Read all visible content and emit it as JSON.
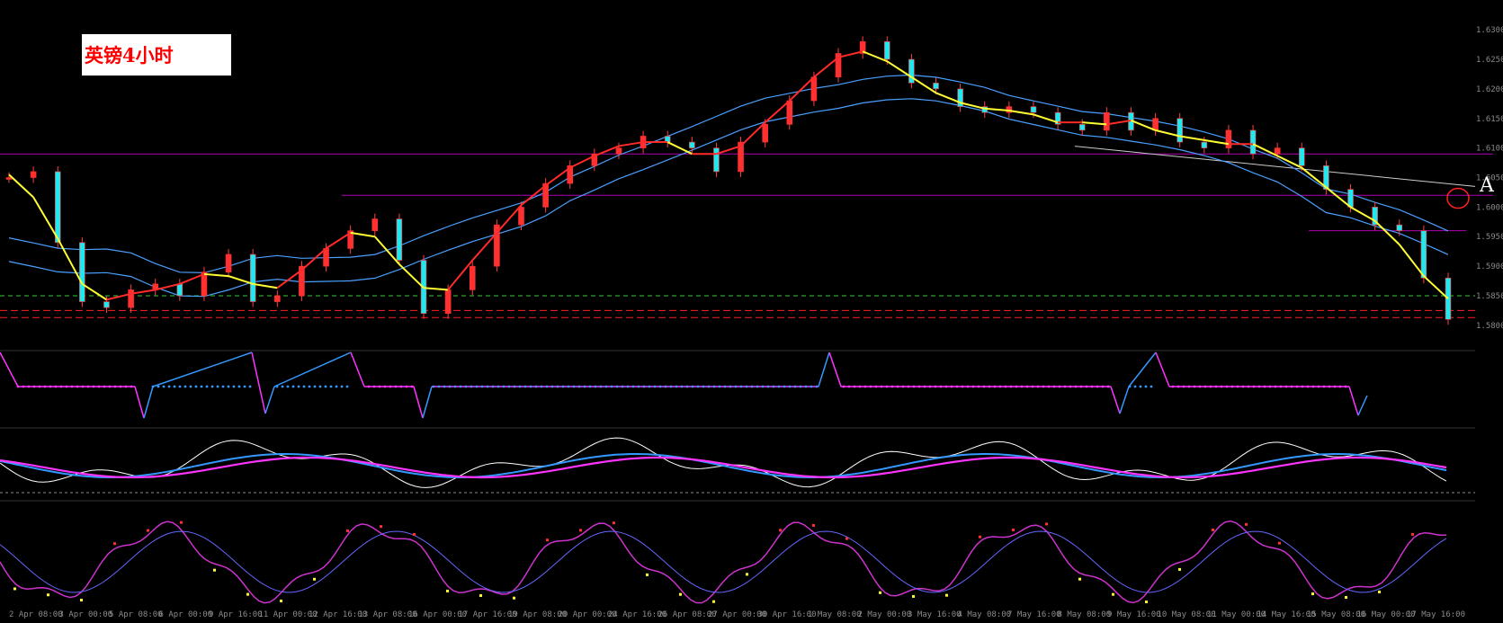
{
  "chart_data": {
    "type": "candlestick",
    "title": "英镑4小时",
    "annotation": "A",
    "x_ticks": [
      "2 Apr 08:00",
      "3 Apr 00:00",
      "5 Apr 08:00",
      "6 Apr 00:00",
      "9 Apr 16:00",
      "11 Apr 00:00",
      "12 Apr 16:00",
      "13 Apr 08:00",
      "16 Apr 00:00",
      "17 Apr 16:00",
      "19 Apr 08:00",
      "20 Apr 00:00",
      "24 Apr 16:00",
      "26 Apr 08:00",
      "27 Apr 00:00",
      "30 Apr 16:00",
      "1 May 08:00",
      "2 May 00:00",
      "3 May 16:00",
      "4 May 08:00",
      "7 May 16:00",
      "8 May 08:00",
      "9 May 16:00",
      "10 May 08:00",
      "11 May 00:00",
      "14 May 16:00",
      "15 May 08:00",
      "16 May 00:00",
      "17 May 16:00"
    ],
    "close_path": [
      1.605,
      1.606,
      1.594,
      1.584,
      1.583,
      1.586,
      1.587,
      1.585,
      1.589,
      1.592,
      1.584,
      1.585,
      1.59,
      1.593,
      1.596,
      1.598,
      1.591,
      1.582,
      1.586,
      1.59,
      1.597,
      1.6,
      1.604,
      1.607,
      1.609,
      1.61,
      1.612,
      1.611,
      1.61,
      1.606,
      1.611,
      1.614,
      1.618,
      1.622,
      1.626,
      1.628,
      1.625,
      1.621,
      1.62,
      1.617,
      1.616,
      1.617,
      1.616,
      1.614,
      1.613,
      1.616,
      1.613,
      1.615,
      1.611,
      1.61,
      1.613,
      1.609,
      1.61,
      1.607,
      1.603,
      1.6,
      1.597,
      1.596,
      1.588,
      1.581
    ],
    "panels": [
      "main",
      "signal",
      "oscillator",
      "stochastic"
    ]
  }
}
